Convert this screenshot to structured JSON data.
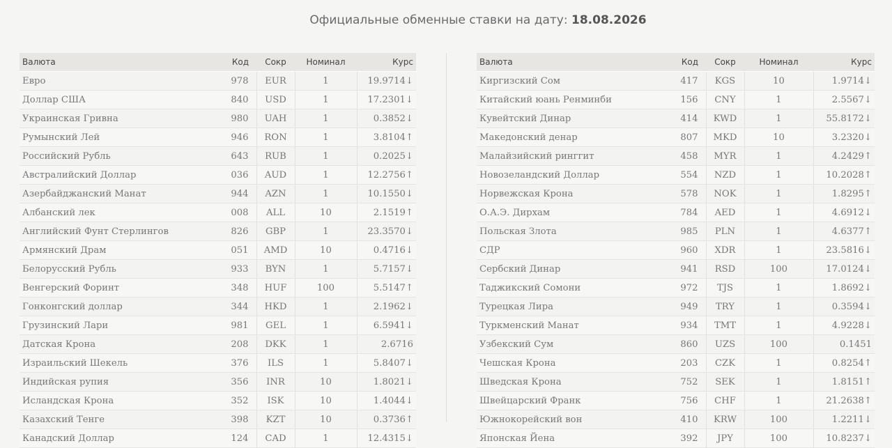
{
  "header": {
    "title_prefix": "Официальные обменные ставки на дату:",
    "date": "18.08.2026"
  },
  "columns": {
    "currency": "Валюта",
    "code": "Код",
    "abbr": "Сокр",
    "nominal": "Номинал",
    "rate": "Курс"
  },
  "arrows": {
    "up": "↑",
    "down": "↓"
  },
  "colors": {
    "up": "#2eab5c",
    "down": "#e8441a",
    "header_bg": "#e7e6e3"
  },
  "left_table": [
    {
      "name": "Евро",
      "code": "978",
      "abbr": "EUR",
      "nominal": "1",
      "rate": "19.9714",
      "trend": "down"
    },
    {
      "name": "Доллар США",
      "code": "840",
      "abbr": "USD",
      "nominal": "1",
      "rate": "17.2301",
      "trend": "down"
    },
    {
      "name": "Украинская Гривна",
      "code": "980",
      "abbr": "UAH",
      "nominal": "1",
      "rate": "0.3852",
      "trend": "down"
    },
    {
      "name": "Румынский Лей",
      "code": "946",
      "abbr": "RON",
      "nominal": "1",
      "rate": "3.8104",
      "trend": "up"
    },
    {
      "name": "Российский Рубль",
      "code": "643",
      "abbr": "RUB",
      "nominal": "1",
      "rate": "0.2025",
      "trend": "down"
    },
    {
      "name": "Австралийский Доллар",
      "code": "036",
      "abbr": "AUD",
      "nominal": "1",
      "rate": "12.2756",
      "trend": "up"
    },
    {
      "name": "Азербайджанский Манат",
      "code": "944",
      "abbr": "AZN",
      "nominal": "1",
      "rate": "10.1550",
      "trend": "down"
    },
    {
      "name": "Албанский лек",
      "code": "008",
      "abbr": "ALL",
      "nominal": "10",
      "rate": "2.1519",
      "trend": "up"
    },
    {
      "name": "Английский Фунт Стерлингов",
      "code": "826",
      "abbr": "GBP",
      "nominal": "1",
      "rate": "23.3570",
      "trend": "down"
    },
    {
      "name": "Армянский Драм",
      "code": "051",
      "abbr": "AMD",
      "nominal": "10",
      "rate": "0.4716",
      "trend": "down"
    },
    {
      "name": "Белорусский Рубль",
      "code": "933",
      "abbr": "BYN",
      "nominal": "1",
      "rate": "5.7157",
      "trend": "down"
    },
    {
      "name": "Венгерский Форинт",
      "code": "348",
      "abbr": "HUF",
      "nominal": "100",
      "rate": "5.5147",
      "trend": "up"
    },
    {
      "name": "Гонконгский доллар",
      "code": "344",
      "abbr": "HKD",
      "nominal": "1",
      "rate": "2.1962",
      "trend": "down"
    },
    {
      "name": "Грузинский Лари",
      "code": "981",
      "abbr": "GEL",
      "nominal": "1",
      "rate": "6.5941",
      "trend": "down"
    },
    {
      "name": "Датская Крона",
      "code": "208",
      "abbr": "DKK",
      "nominal": "1",
      "rate": "2.6716",
      "trend": "flat"
    },
    {
      "name": "Израильский Шекель",
      "code": "376",
      "abbr": "ILS",
      "nominal": "1",
      "rate": "5.8407",
      "trend": "down"
    },
    {
      "name": "Индийская рупия",
      "code": "356",
      "abbr": "INR",
      "nominal": "10",
      "rate": "1.8021",
      "trend": "down"
    },
    {
      "name": "Исландская Крона",
      "code": "352",
      "abbr": "ISK",
      "nominal": "10",
      "rate": "1.4044",
      "trend": "down"
    },
    {
      "name": "Казахский Тенге",
      "code": "398",
      "abbr": "KZT",
      "nominal": "10",
      "rate": "0.3736",
      "trend": "up"
    },
    {
      "name": "Канадский Доллар",
      "code": "124",
      "abbr": "CAD",
      "nominal": "1",
      "rate": "12.4315",
      "trend": "down"
    }
  ],
  "right_table": [
    {
      "name": "Киргизский Сом",
      "code": "417",
      "abbr": "KGS",
      "nominal": "10",
      "rate": "1.9714",
      "trend": "down"
    },
    {
      "name": "Китайский юань Ренминби",
      "code": "156",
      "abbr": "CNY",
      "nominal": "1",
      "rate": "2.5567",
      "trend": "down"
    },
    {
      "name": "Кувейтский Динар",
      "code": "414",
      "abbr": "KWD",
      "nominal": "1",
      "rate": "55.8172",
      "trend": "down"
    },
    {
      "name": "Македонский денар",
      "code": "807",
      "abbr": "MKD",
      "nominal": "10",
      "rate": "3.2320",
      "trend": "down"
    },
    {
      "name": "Малайзийский ринггит",
      "code": "458",
      "abbr": "MYR",
      "nominal": "1",
      "rate": "4.2429",
      "trend": "up"
    },
    {
      "name": "Новозеландский Доллар",
      "code": "554",
      "abbr": "NZD",
      "nominal": "1",
      "rate": "10.2028",
      "trend": "up"
    },
    {
      "name": "Норвежская Крона",
      "code": "578",
      "abbr": "NOK",
      "nominal": "1",
      "rate": "1.8295",
      "trend": "up"
    },
    {
      "name": "О.А.Э. Дирхам",
      "code": "784",
      "abbr": "AED",
      "nominal": "1",
      "rate": "4.6912",
      "trend": "down"
    },
    {
      "name": "Польская Злота",
      "code": "985",
      "abbr": "PLN",
      "nominal": "1",
      "rate": "4.6377",
      "trend": "up"
    },
    {
      "name": "СДР",
      "code": "960",
      "abbr": "XDR",
      "nominal": "1",
      "rate": "23.5816",
      "trend": "down"
    },
    {
      "name": "Сербский Динар",
      "code": "941",
      "abbr": "RSD",
      "nominal": "100",
      "rate": "17.0124",
      "trend": "down"
    },
    {
      "name": "Таджикский Сомони",
      "code": "972",
      "abbr": "TJS",
      "nominal": "1",
      "rate": "1.8692",
      "trend": "down"
    },
    {
      "name": "Турецкая Лира",
      "code": "949",
      "abbr": "TRY",
      "nominal": "1",
      "rate": "0.3594",
      "trend": "down"
    },
    {
      "name": "Туркменский Манат",
      "code": "934",
      "abbr": "TMT",
      "nominal": "1",
      "rate": "4.9228",
      "trend": "down"
    },
    {
      "name": "Узбекский Сум",
      "code": "860",
      "abbr": "UZS",
      "nominal": "100",
      "rate": "0.1451",
      "trend": "flat"
    },
    {
      "name": "Чешская Крона",
      "code": "203",
      "abbr": "CZK",
      "nominal": "1",
      "rate": "0.8254",
      "trend": "up"
    },
    {
      "name": "Шведская Крона",
      "code": "752",
      "abbr": "SEK",
      "nominal": "1",
      "rate": "1.8151",
      "trend": "up"
    },
    {
      "name": "Швейцарский Франк",
      "code": "756",
      "abbr": "CHF",
      "nominal": "1",
      "rate": "21.2638",
      "trend": "up"
    },
    {
      "name": "Южнокорейский вон",
      "code": "410",
      "abbr": "KRW",
      "nominal": "100",
      "rate": "1.2211",
      "trend": "down"
    },
    {
      "name": "Японская Йена",
      "code": "392",
      "abbr": "JPY",
      "nominal": "100",
      "rate": "10.8237",
      "trend": "down"
    }
  ]
}
